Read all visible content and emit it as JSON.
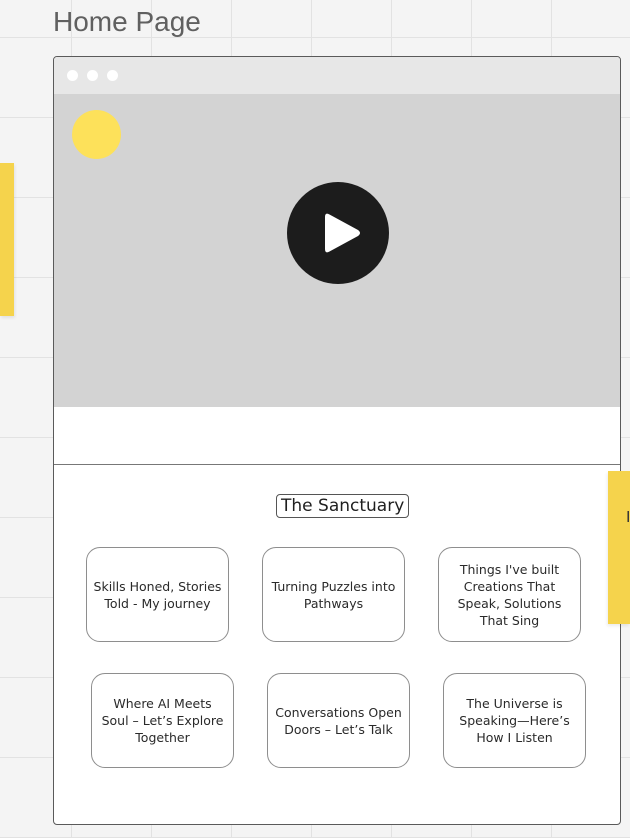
{
  "page": {
    "title": "Home Page"
  },
  "sticky_notes": {
    "right_text": "I"
  },
  "browser": {
    "window_dots": [
      "dot-1",
      "dot-2",
      "dot-3"
    ],
    "video": {
      "icon": "play-icon",
      "accent_dot_color": "#fde15a",
      "play_button_color": "#1c1c1c"
    }
  },
  "sanctuary": {
    "title": "The Sanctuary",
    "cards": [
      {
        "label": "Skills Honed, Stories Told - My journey"
      },
      {
        "label": "Turning Puzzles into Pathways"
      },
      {
        "label": "Things I've built Creations That Speak, Solutions That Sing"
      },
      {
        "label": "Where AI Meets Soul – Let’s Explore Together"
      },
      {
        "label": "Conversations Open Doors – Let’s Talk"
      },
      {
        "label": "The Universe is Speaking—Here’s How I Listen"
      }
    ]
  },
  "colors": {
    "sticky_note": "#f5d34c",
    "canvas_background": "#f4f4f4",
    "placeholder_gray": "#d3d3d3"
  }
}
